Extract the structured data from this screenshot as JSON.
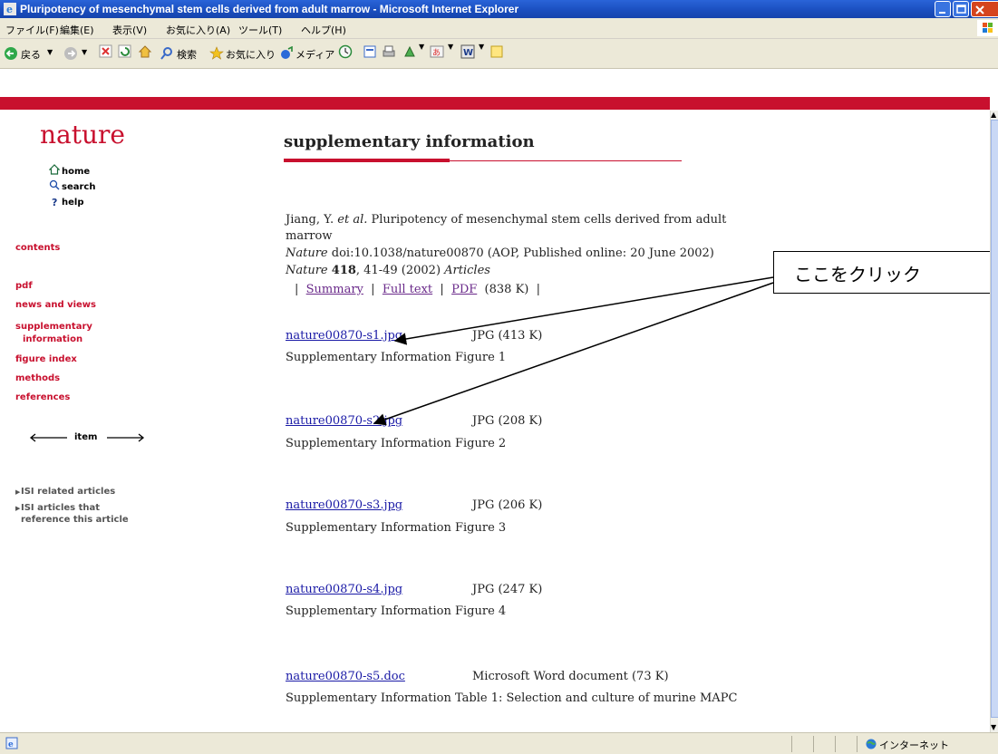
{
  "window": {
    "title": "Pluripotency of mesenchymal stem cells derived from adult marrow - Microsoft Internet Explorer"
  },
  "menu": {
    "items": [
      "ファイル(F)",
      "編集(E)",
      "表示(V)",
      "お気に入り(A)",
      "ツール(T)",
      "ヘルプ(H)"
    ]
  },
  "toolbar": {
    "back_label": "戻る",
    "search_label": "検索",
    "favorites_label": "お気に入り",
    "media_label": "メディア"
  },
  "sidebar": {
    "logo": "nature",
    "home": "home",
    "search": "search",
    "help": "help",
    "contents": "contents",
    "pdf": "pdf",
    "news_and_views": "news and views",
    "supplementary_line1": "supplementary",
    "supplementary_line2": "information",
    "figure_index": "figure index",
    "methods": "methods",
    "references": "references",
    "item": "item",
    "isi_related": "ISI related articles",
    "isi_ref_line1": "ISI articles that",
    "isi_ref_line2": "reference this article"
  },
  "main": {
    "heading": "supplementary information",
    "citation": {
      "authors": "Jiang, Y.",
      "etal": "et al.",
      "title_line1": "Pluripotency of mesenchymal stem cells derived from adult",
      "title_line2": "marrow",
      "journal": "Nature",
      "doi_text": "doi:10.1038/nature00870 (AOP, Published online: 20 June 2002)",
      "journal2": "Nature",
      "volume": "418",
      "pages": ", 41-49 (2002)",
      "section": "Articles"
    },
    "links_bar": {
      "summary": "Summary",
      "full_text": "Full text",
      "pdf": "PDF",
      "pdf_size": "(838  K)"
    },
    "files": [
      {
        "name": "nature00870-s1.jpg",
        "type": "JPG (413 K)",
        "desc": "Supplementary Information Figure 1"
      },
      {
        "name": "nature00870-s2.jpg",
        "type": "JPG (208 K)",
        "desc": "Supplementary Information Figure 2"
      },
      {
        "name": "nature00870-s3.jpg",
        "type": "JPG (206 K)",
        "desc": "Supplementary Information Figure 3"
      },
      {
        "name": "nature00870-s4.jpg",
        "type": "JPG (247 K)",
        "desc": "Supplementary Information Figure 4"
      },
      {
        "name": "nature00870-s5.doc",
        "type": "Microsoft Word document (73 K)",
        "desc": "Supplementary Information Table 1: Selection and culture of murine MAPC"
      }
    ]
  },
  "callout": {
    "text": "ここをクリック"
  },
  "statusbar": {
    "zone": "インターネット"
  },
  "colors": {
    "accent": "#c8102e",
    "link": "#1a1aa6",
    "visited": "#6a2a8a",
    "titlebar": "#1b4fc0"
  }
}
